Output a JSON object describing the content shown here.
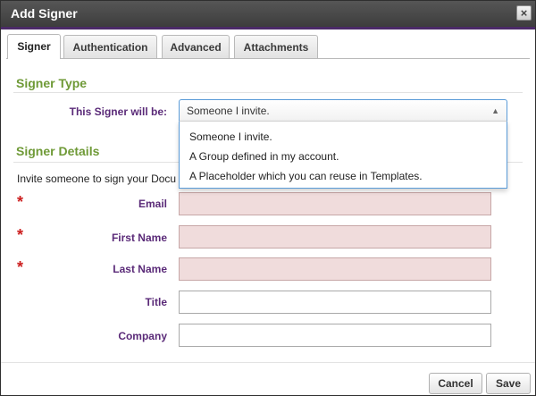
{
  "dialog": {
    "title": "Add Signer",
    "close_symbol": "×"
  },
  "tabs": [
    {
      "label": "Signer",
      "active": true
    },
    {
      "label": "Authentication",
      "active": false
    },
    {
      "label": "Advanced",
      "active": false
    },
    {
      "label": "Attachments",
      "active": false
    }
  ],
  "signer_type": {
    "heading": "Signer Type",
    "label": "This Signer will be:",
    "selected": "Someone I invite.",
    "options": [
      "Someone I invite.",
      "A Group defined in my account.",
      "A Placeholder which you can reuse in Templates."
    ]
  },
  "signer_details": {
    "heading": "Signer Details",
    "intro": "Invite someone to sign your Docu",
    "required_marker": "*",
    "fields": [
      {
        "label": "Email",
        "value": "",
        "required": true
      },
      {
        "label": "First Name",
        "value": "",
        "required": true
      },
      {
        "label": "Last Name",
        "value": "",
        "required": true
      },
      {
        "label": "Title",
        "value": "",
        "required": false
      },
      {
        "label": "Company",
        "value": "",
        "required": false
      }
    ]
  },
  "footer": {
    "cancel_label": "Cancel",
    "save_label": "Save"
  },
  "colors": {
    "accent_purple": "#5a2a78",
    "section_green": "#6f9a37",
    "required_red": "#cc1f1f",
    "required_field_bg": "#f0dcdc"
  }
}
